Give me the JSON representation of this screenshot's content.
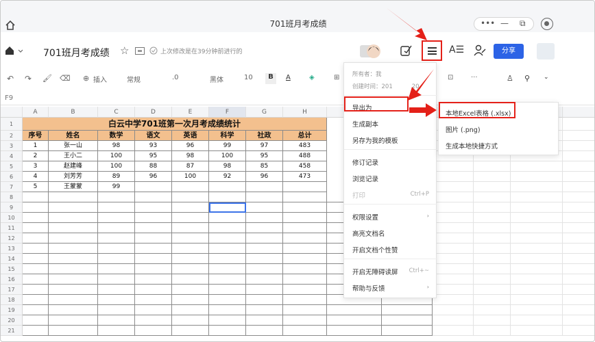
{
  "window": {
    "title": "701班月考成绩"
  },
  "doc": {
    "title": "701班月考成绩",
    "saved_status": "上次修改是在39分钟前进行的",
    "share_label": "分享"
  },
  "toolbar": {
    "insert_label": "插入",
    "format_label": "常规",
    "font_name": "黑体",
    "font_size": "10",
    "bold_label": "B",
    "font_color_label": "A",
    "more_label": "···"
  },
  "namebox": "F9",
  "columns": [
    "A",
    "B",
    "C",
    "D",
    "E",
    "F",
    "G",
    "H"
  ],
  "sheet": {
    "title": "白云中学701班第一次月考成绩统计",
    "headers": [
      "序号",
      "姓名",
      "数学",
      "语文",
      "英语",
      "科学",
      "社政",
      "总计"
    ],
    "rows": [
      [
        "1",
        "张一山",
        "98",
        "93",
        "96",
        "99",
        "97",
        "483"
      ],
      [
        "2",
        "王小二",
        "100",
        "95",
        "98",
        "100",
        "95",
        "488"
      ],
      [
        "3",
        "赵建峰",
        "100",
        "88",
        "87",
        "98",
        "85",
        "458"
      ],
      [
        "4",
        "刘芳芳",
        "89",
        "96",
        "100",
        "92",
        "96",
        "473"
      ],
      [
        "5",
        "王蒙蒙",
        "99",
        "",
        "",
        "",
        "",
        ""
      ]
    ],
    "row_numbers": [
      "1",
      "2",
      "3",
      "4",
      "5",
      "6",
      "7",
      "8",
      "9",
      "10",
      "11",
      "12",
      "13",
      "14",
      "15",
      "16",
      "17",
      "18",
      "19",
      "20",
      "21"
    ]
  },
  "menu": {
    "owner": "所有者：",
    "owner_name": "我",
    "created": "创建时间：",
    "created_value": "201",
    "created_value_end": "20",
    "items": [
      {
        "label": "导出为",
        "arrow": "›"
      },
      {
        "label": "生成副本"
      },
      {
        "label": "另存为我的模板"
      },
      {
        "label": "修订记录"
      },
      {
        "label": "浏览记录"
      },
      {
        "label": "打印",
        "shortcut": "Ctrl+P",
        "disabled": true
      },
      {
        "label": "权限设置",
        "arrow": "›"
      },
      {
        "label": "高亮文档名"
      },
      {
        "label": "开启文档个性赞"
      },
      {
        "label": "开启无障碍读屏",
        "shortcut": "Ctrl+~"
      },
      {
        "label": "帮助与反馈",
        "arrow": "›"
      }
    ]
  },
  "submenu": {
    "items": [
      {
        "label": "本地Excel表格 (.xlsx)"
      },
      {
        "label": "图片 (.png)"
      },
      {
        "label": "生成本地快捷方式"
      }
    ]
  },
  "colors": {
    "accent": "#2c63e6",
    "highlight": "#e42018",
    "header_fill": "#f3c08e"
  }
}
